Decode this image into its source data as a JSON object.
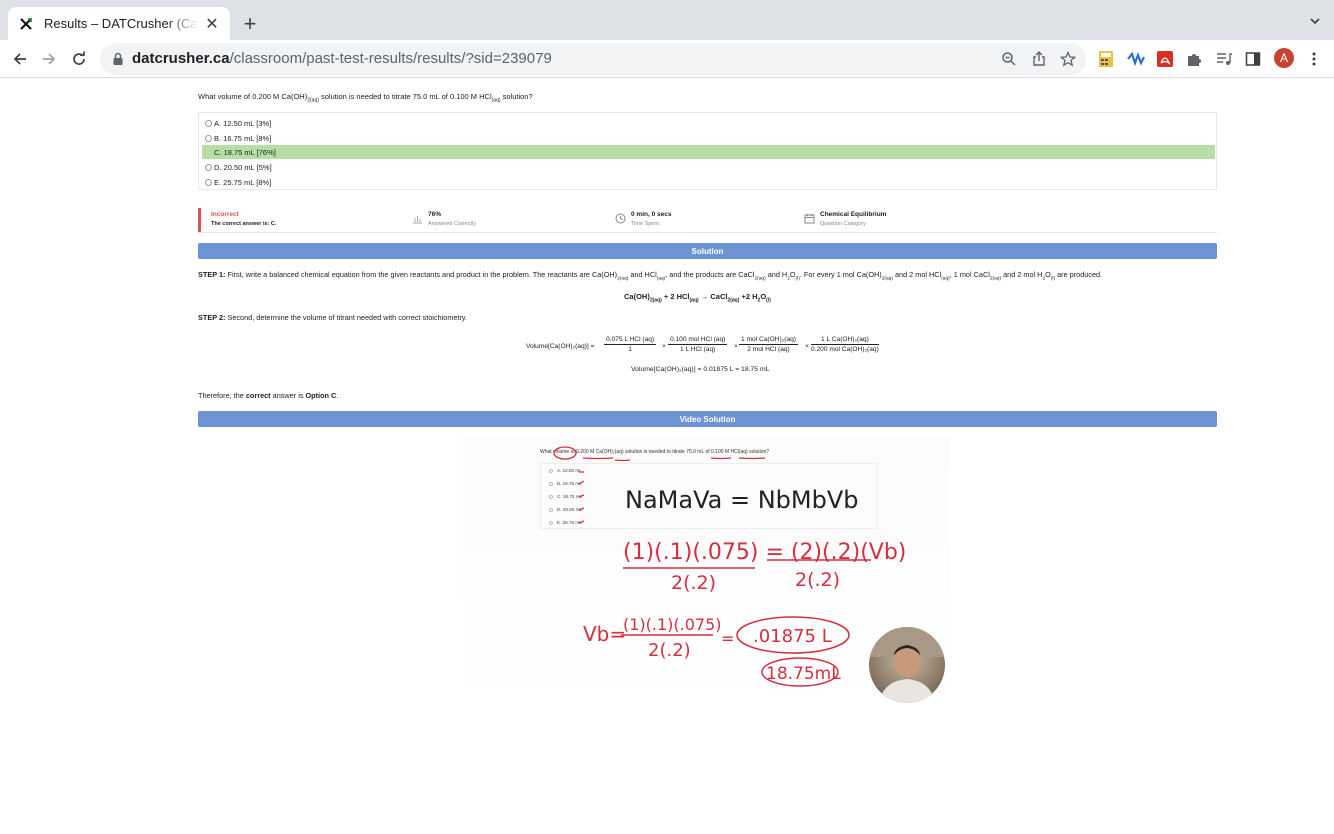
{
  "browser": {
    "tab_title": "Results – DATCrusher (Canadian",
    "url_host": "datcrusher.ca",
    "url_path": "/classroom/past-test-results/results/?sid=239079",
    "avatar_letter": "A"
  },
  "question": {
    "prefix": "What volume of 0.200 M Ca(OH)",
    "sub1": "2(aq)",
    "middle": " solution is needed to titrate 75.0 mL of 0.100 M HCl",
    "sub2": "(aq)",
    "suffix": " solution?"
  },
  "choices": [
    {
      "label": "A. 12.50 mL [3%]",
      "correct": false
    },
    {
      "label": "B. 16.75 mL [8%]",
      "correct": false
    },
    {
      "label": "C. 18.75 mL [76%]",
      "correct": true
    },
    {
      "label": "D. 20.50 mL [5%]",
      "correct": false
    },
    {
      "label": "E. 25.75 mL [8%]",
      "correct": false
    }
  ],
  "stats": {
    "result": "Incorrect",
    "result_sub": "The correct answer is: C.",
    "percent": "76%",
    "percent_sub": "Answered Correctly",
    "time": "0 min, 0 secs",
    "time_sub": "Time Spent",
    "category": "Chemical Equilibrium",
    "category_sub": "Question Category"
  },
  "solution": {
    "header": "Solution",
    "step1_label": "STEP 1:",
    "step1_text": " First, write a balanced chemical equation from the given reactants and product in the problem. The reactants are Ca(OH)",
    "step1_sub_a": "2(aq)",
    "step1_t2": " and HCl",
    "step1_sub_b": "(aq)",
    "step1_t3": ", and the products are CaCl",
    "step1_sub_c": "2(aq)",
    "step1_t4": " and H",
    "step1_sub_d": "2",
    "step1_t5": "O",
    "step1_sub_e": "(l)",
    "step1_t6": ". For every 1 mol Ca(OH)",
    "step1_sub_f": "2(aq)",
    "step1_t7": " and 2 mol HCl",
    "step1_sub_g": "(aq)",
    "step1_t8": ", 1 mol CaCl",
    "step1_sub_h": "2(aq)",
    "step1_t9": " and 2 mol H",
    "step1_sub_i": "2",
    "step1_t10": "O",
    "step1_sub_j": "(l)",
    "step1_t11": " are produced.",
    "equation": {
      "a": "Ca(OH)",
      "a_sub": "2(aq)",
      "b": " + 2 HCl",
      "b_sub": "(aq)",
      "c": " → CaCl",
      "c_sub": "2(aq)",
      "d": " +2 H",
      "d_sub": "2",
      "e": "O",
      "e_sub": "(l)"
    },
    "step2_label": "STEP 2:",
    "step2_text": " Second, determine the volume of titrant needed with correct stoichiometry.",
    "calc_lhs": "Volume[Ca(OH)₂(aq)] =",
    "fractions": [
      {
        "num": "0.075 L HCl (aq)",
        "den": "1"
      },
      {
        "num": "0.100 mol HCl (aq)",
        "den": "1 L HCl (aq)"
      },
      {
        "num": "1 mol Ca(OH)₂(aq)",
        "den": "2 mol HCl (aq)"
      },
      {
        "num": "1 L Ca(OH)₂(aq)",
        "den": "0.200 mol Ca(OH)₂(aq)"
      }
    ],
    "times": "×",
    "result_line": "Volume[Ca(OH)₂(aq)] = 0.01875 L = 18.75 mL",
    "conclusion_a": "Therefore, the ",
    "conclusion_b": "correct",
    "conclusion_c": " answer is ",
    "conclusion_d": "Option C",
    "conclusion_e": "."
  },
  "video": {
    "header": "Video Solution",
    "question": "What volume of 0.200 M Ca(OH)₂(aq) solution is needed to titrate 75.0 mL of 0.100 M HCl(aq) solution?",
    "choices": [
      "A. 12.50 mL",
      "B. 16.75 mL",
      "C. 18.75 mL",
      "D. 20.50 mL",
      "E. 25.75 mL"
    ],
    "ink_formula": "NaMaVa = NbMbVb",
    "ink_line1_left": "(1)(.1)(.075) = (2)(.2)(Vb)",
    "ink_den": "2(.2)",
    "ink_vb": "Vb=",
    "ink_vb_num": "(1)(.1)(.075)",
    "ink_result": ".01875 L",
    "ink_result2": "18.75mL"
  }
}
